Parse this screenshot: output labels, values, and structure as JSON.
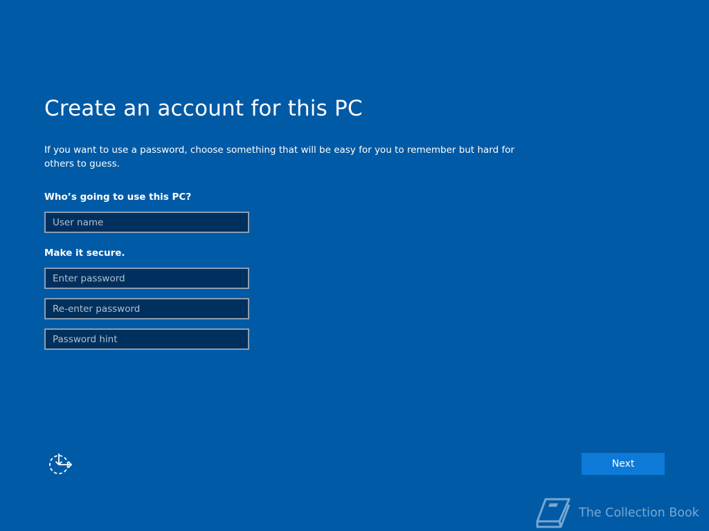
{
  "page": {
    "title": "Create an account for this PC",
    "description": "If you want to use a password, choose something that will be easy for you to remember but hard for others to guess."
  },
  "user_section": {
    "label": "Who’s going to use this PC?",
    "username_placeholder": "User name",
    "username_value": ""
  },
  "security_section": {
    "label": "Make it secure.",
    "password_placeholder": "Enter password",
    "reenter_placeholder": "Re-enter password",
    "hint_placeholder": "Password hint"
  },
  "footer": {
    "accessibility_icon": "ease-of-access-icon",
    "next_label": "Next"
  },
  "watermark": {
    "text": "The Collection Book",
    "icon": "book-icon"
  },
  "colors": {
    "background": "#005aa6",
    "field_background": "#00305e",
    "field_border": "#8c9fb3",
    "accent_button": "#0d7ad8",
    "text": "#ffffff"
  }
}
